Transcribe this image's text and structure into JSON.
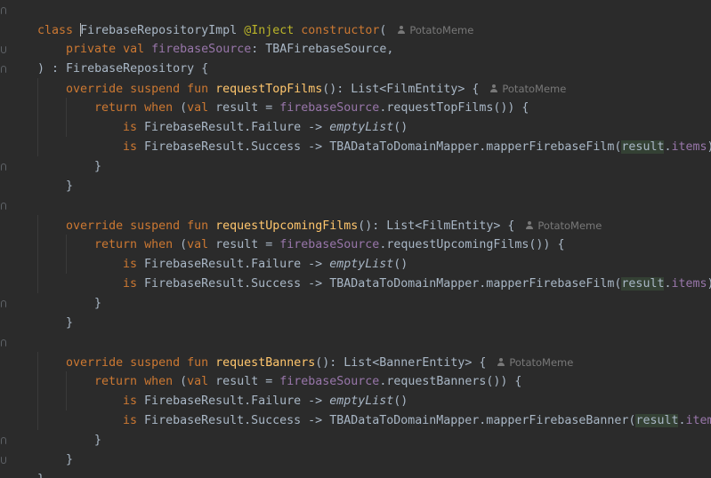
{
  "editor": {
    "author_hint": "PotatoMeme",
    "lines": {
      "l1": {
        "kw_class": "class",
        "class_name": "FirebaseRepositoryImpl",
        "ann": "@Inject",
        "kw_ctor": "constructor",
        "paren": "("
      },
      "l2": {
        "kw_private": "private",
        "kw_val": "val",
        "prop_name": "firebaseSource",
        "type": ": TBAFirebaseSource,"
      },
      "l3": {
        "text": ") : FirebaseRepository {"
      },
      "l4": {
        "kw": "override suspend fun",
        "fn": "requestTopFilms",
        "rest": "(): List<FilmEntity> {"
      },
      "l5": {
        "kw_return": "return",
        "kw_when": "when",
        "open": " (",
        "kw_val": "val",
        "mid": " result = ",
        "prop": "firebaseSource",
        "call": ".requestTopFilms()) {"
      },
      "l6": {
        "kw_is": "is",
        "mid": " FirebaseResult.Failure -> ",
        "ital": "emptyList",
        "end": "()"
      },
      "l7": {
        "kw_is": "is",
        "mid": " FirebaseResult.Success -> TBADataToDomainMapper.mapperFirebaseFilm(",
        "hl_result": "result",
        "dot": ".",
        "items": "items",
        "end": ")"
      },
      "l8": {
        "text": "}"
      },
      "l9": {
        "text": "}"
      },
      "l11": {
        "kw": "override suspend fun",
        "fn": "requestUpcomingFilms",
        "rest": "(): List<FilmEntity> {"
      },
      "l12": {
        "kw_return": "return",
        "kw_when": "when",
        "open": " (",
        "kw_val": "val",
        "mid": " result = ",
        "prop": "firebaseSource",
        "call": ".requestUpcomingFilms()) {"
      },
      "l13": {
        "kw_is": "is",
        "mid": " FirebaseResult.Failure -> ",
        "ital": "emptyList",
        "end": "()"
      },
      "l14": {
        "kw_is": "is",
        "mid": " FirebaseResult.Success -> TBADataToDomainMapper.mapperFirebaseFilm(",
        "hl_result": "result",
        "dot": ".",
        "items": "items",
        "end": ")"
      },
      "l15": {
        "text": "}"
      },
      "l16": {
        "text": "}"
      },
      "l18": {
        "kw": "override suspend fun",
        "fn": "requestBanners",
        "rest": "(): List<BannerEntity> {"
      },
      "l19": {
        "kw_return": "return",
        "kw_when": "when",
        "open": " (",
        "kw_val": "val",
        "mid": " result = ",
        "prop": "firebaseSource",
        "call": ".requestBanners()) {"
      },
      "l20": {
        "kw_is": "is",
        "mid": " FirebaseResult.Failure -> ",
        "ital": "emptyList",
        "end": "()"
      },
      "l21": {
        "kw_is": "is",
        "mid": " FirebaseResult.Success -> TBADataToDomainMapper.mapperFirebaseBanner(",
        "hl_result": "result",
        "dot": ".",
        "items": "items",
        "end": ")"
      },
      "l22": {
        "text": "}"
      },
      "l23": {
        "text": "}"
      },
      "l24": {
        "text": "}"
      }
    }
  },
  "colors": {
    "background": "#2b2b2b",
    "keyword": "#cc7832",
    "annotation": "#bbb529",
    "property": "#9876aa",
    "function": "#ffc66d",
    "text": "#a9b7c6",
    "hint": "#787878"
  }
}
